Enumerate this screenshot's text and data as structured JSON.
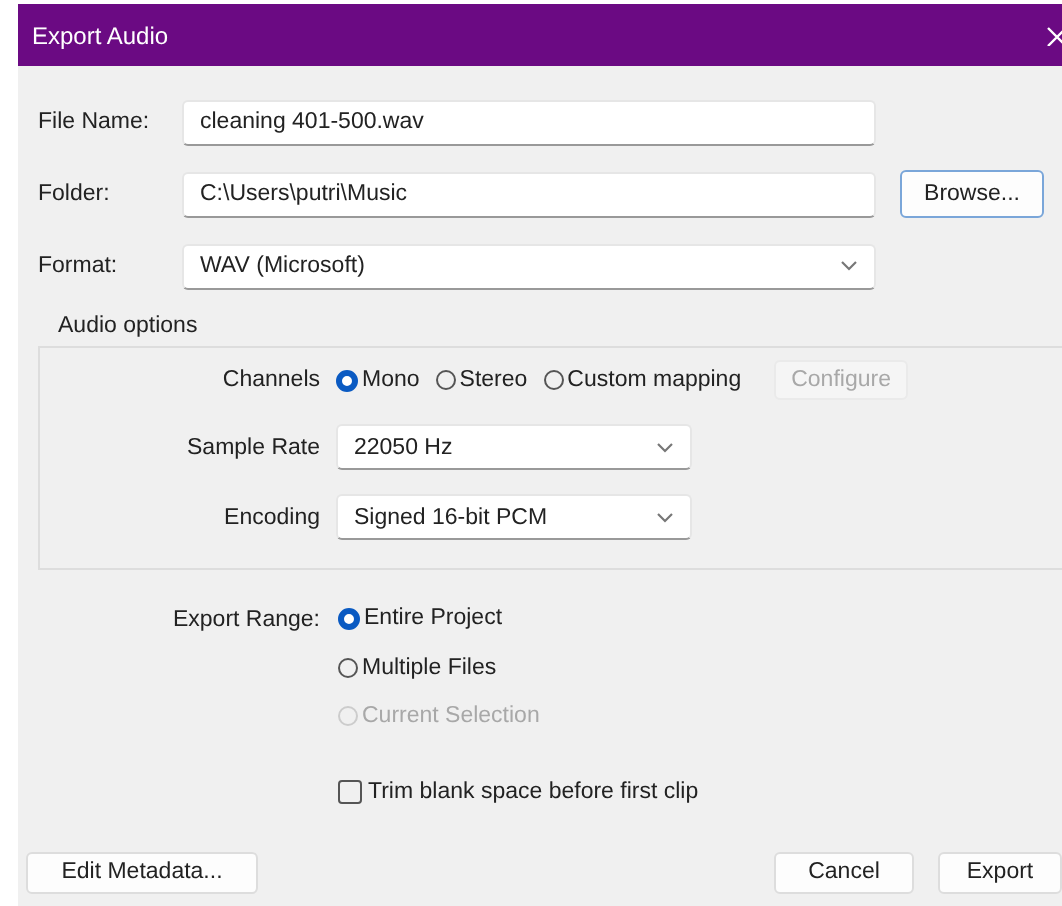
{
  "window": {
    "title": "Export Audio"
  },
  "file_name": {
    "label": "File Name:",
    "value": "cleaning 401-500.wav"
  },
  "folder": {
    "label": "Folder:",
    "value": "C:\\Users\\putri\\Music",
    "button": "Browse..."
  },
  "format": {
    "label": "Format:",
    "value": "WAV (Microsoft)"
  },
  "audio_options": {
    "title": "Audio options",
    "channels": {
      "label": "Channels",
      "options": [
        {
          "label": "Mono",
          "selected": true,
          "disabled": false
        },
        {
          "label": "Stereo",
          "selected": false,
          "disabled": false
        },
        {
          "label": "Custom mapping",
          "selected": false,
          "disabled": false
        }
      ]
    },
    "configure": {
      "label": "Configure",
      "disabled": true
    },
    "sample_rate": {
      "label": "Sample Rate",
      "value": "22050 Hz"
    },
    "encoding": {
      "label": "Encoding",
      "value": "Signed 16-bit PCM"
    }
  },
  "export_range": {
    "label": "Export Range:",
    "options": [
      {
        "label": "Entire Project",
        "selected": true,
        "disabled": false
      },
      {
        "label": "Multiple Files",
        "selected": false,
        "disabled": false
      },
      {
        "label": "Current Selection",
        "selected": false,
        "disabled": true
      }
    ]
  },
  "trim": {
    "label": "Trim blank space before first clip",
    "checked": false
  },
  "buttons": [
    {
      "label": "Edit Metadata..."
    },
    {
      "label": "Cancel"
    },
    {
      "label": "Export"
    }
  ]
}
